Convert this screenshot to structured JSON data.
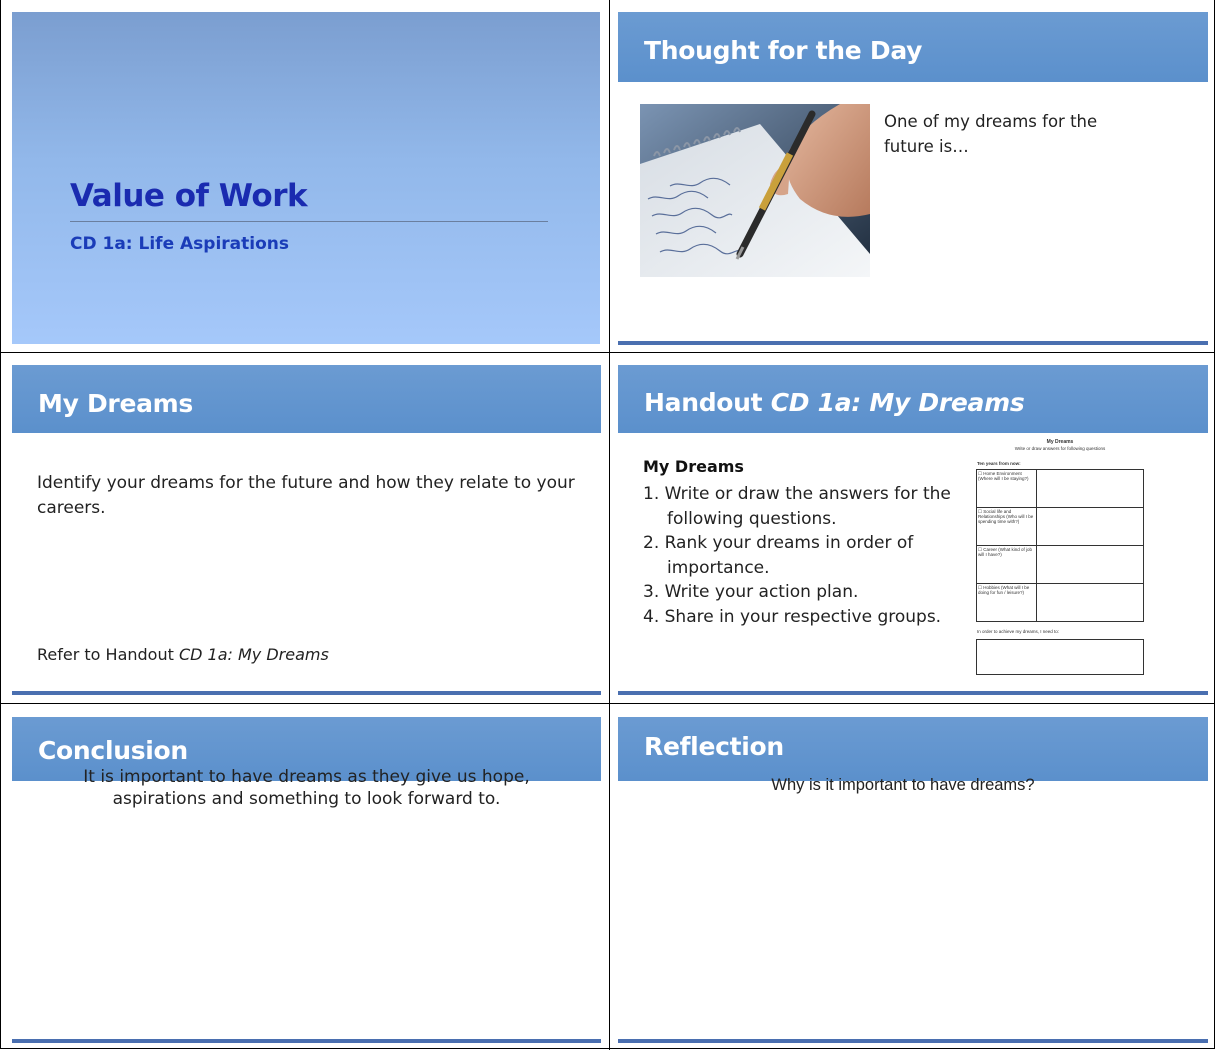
{
  "slides": {
    "title": {
      "heading": "Value of Work",
      "subheading": "CD 1a: Life Aspirations"
    },
    "thought": {
      "header": "Thought for the Day",
      "text": "One of my dreams for the future is…"
    },
    "dreams": {
      "header": "My Dreams",
      "text": "Identify your dreams for the future and how they relate to your careers.",
      "refer_prefix": "Refer to Handout ",
      "refer_italic": "CD 1a: My Dreams"
    },
    "handout": {
      "header_prefix": "Handout ",
      "header_italic": "CD 1a: My Dreams",
      "subtitle": "My Dreams",
      "steps": [
        "1. Write or draw the answers for the",
        "following questions.",
        "2. Rank your dreams in order of",
        "importance.",
        "3. Write your action plan.",
        "4. Share in your respective groups."
      ],
      "thumb": {
        "title": "My Dreams",
        "instruction": "Write or draw answers for following questions",
        "lead": "Ten years from now:",
        "rows": [
          "☐ Home Environment (Where will I be staying?)",
          "☐ Social life and Relationships (Who will I be spending time with?)",
          "☐ Career (What kind of job will I have?)",
          "☐ Hobbies (What will I be doing for fun / leisure?)"
        ],
        "plan": "In order to achieve my dreams, I need to:"
      }
    },
    "conclusion": {
      "header": "Conclusion",
      "line1": "It is important to have dreams as they give us hope,",
      "line2": "aspirations and something to look forward to."
    },
    "reflection": {
      "header": "Reflection",
      "text": "Why is it important to have dreams?"
    }
  }
}
